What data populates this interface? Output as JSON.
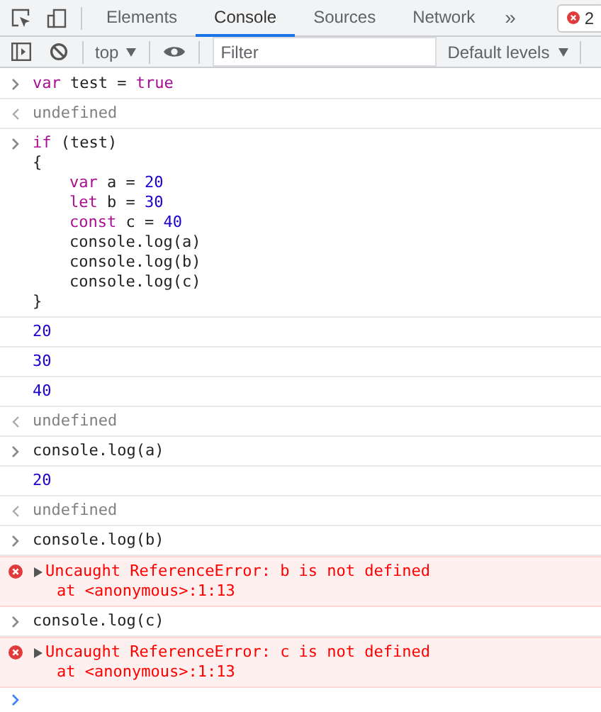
{
  "tabs": [
    {
      "label": "Elements",
      "selected": false
    },
    {
      "label": "Console",
      "selected": true
    },
    {
      "label": "Sources",
      "selected": false
    },
    {
      "label": "Network",
      "selected": false
    }
  ],
  "more_tabs": "»",
  "error_count": "2",
  "toolbar": {
    "context": "top",
    "filter": {
      "placeholder": "Filter"
    },
    "levels": "Default levels"
  },
  "entries": [
    {
      "kind": "input",
      "lines": [
        {
          "indented": false,
          "tokens": [
            {
              "text": "var",
              "kind": "keyword"
            },
            {
              "text": " test = ",
              "kind": "plain"
            },
            {
              "text": "true",
              "kind": "keyword"
            }
          ]
        }
      ]
    },
    {
      "kind": "return",
      "text": "undefined"
    },
    {
      "kind": "input",
      "lines": [
        {
          "indented": false,
          "tokens": [
            {
              "text": "if",
              "kind": "keyword"
            },
            {
              "text": " (test)",
              "kind": "plain"
            }
          ]
        },
        {
          "indented": false,
          "tokens": [
            {
              "text": "{",
              "kind": "plain"
            }
          ]
        },
        {
          "indented": true,
          "tokens": [
            {
              "text": "var",
              "kind": "keyword"
            },
            {
              "text": " a = ",
              "kind": "plain"
            },
            {
              "text": "20",
              "kind": "number"
            }
          ]
        },
        {
          "indented": true,
          "tokens": [
            {
              "text": "let",
              "kind": "keyword"
            },
            {
              "text": " b = ",
              "kind": "plain"
            },
            {
              "text": "30",
              "kind": "number"
            }
          ]
        },
        {
          "indented": true,
          "tokens": [
            {
              "text": "const",
              "kind": "keyword"
            },
            {
              "text": " c = ",
              "kind": "plain"
            },
            {
              "text": "40",
              "kind": "number"
            }
          ]
        },
        {
          "indented": true,
          "tokens": [
            {
              "text": "console.log(a)",
              "kind": "plain"
            }
          ]
        },
        {
          "indented": true,
          "tokens": [
            {
              "text": "console.log(b)",
              "kind": "plain"
            }
          ]
        },
        {
          "indented": true,
          "tokens": [
            {
              "text": "console.log(c)",
              "kind": "plain"
            }
          ]
        },
        {
          "indented": false,
          "tokens": [
            {
              "text": "}",
              "kind": "plain"
            }
          ]
        }
      ]
    },
    {
      "kind": "output",
      "text": "20"
    },
    {
      "kind": "output",
      "text": "30"
    },
    {
      "kind": "output",
      "text": "40"
    },
    {
      "kind": "return",
      "text": "undefined"
    },
    {
      "kind": "input",
      "lines": [
        {
          "indented": false,
          "tokens": [
            {
              "text": "console.log(a)",
              "kind": "plain"
            }
          ]
        }
      ]
    },
    {
      "kind": "output",
      "text": "20"
    },
    {
      "kind": "return",
      "text": "undefined"
    },
    {
      "kind": "input",
      "lines": [
        {
          "indented": false,
          "tokens": [
            {
              "text": "console.log(b)",
              "kind": "plain"
            }
          ]
        }
      ]
    },
    {
      "kind": "error",
      "text": "Uncaught ReferenceError: b is not defined",
      "trace": "at <anonymous>:1:13"
    },
    {
      "kind": "input",
      "lines": [
        {
          "indented": false,
          "tokens": [
            {
              "text": "console.log(c)",
              "kind": "plain"
            }
          ]
        }
      ]
    },
    {
      "kind": "error",
      "text": "Uncaught ReferenceError: c is not defined",
      "trace": "at <anonymous>:1:13"
    }
  ]
}
